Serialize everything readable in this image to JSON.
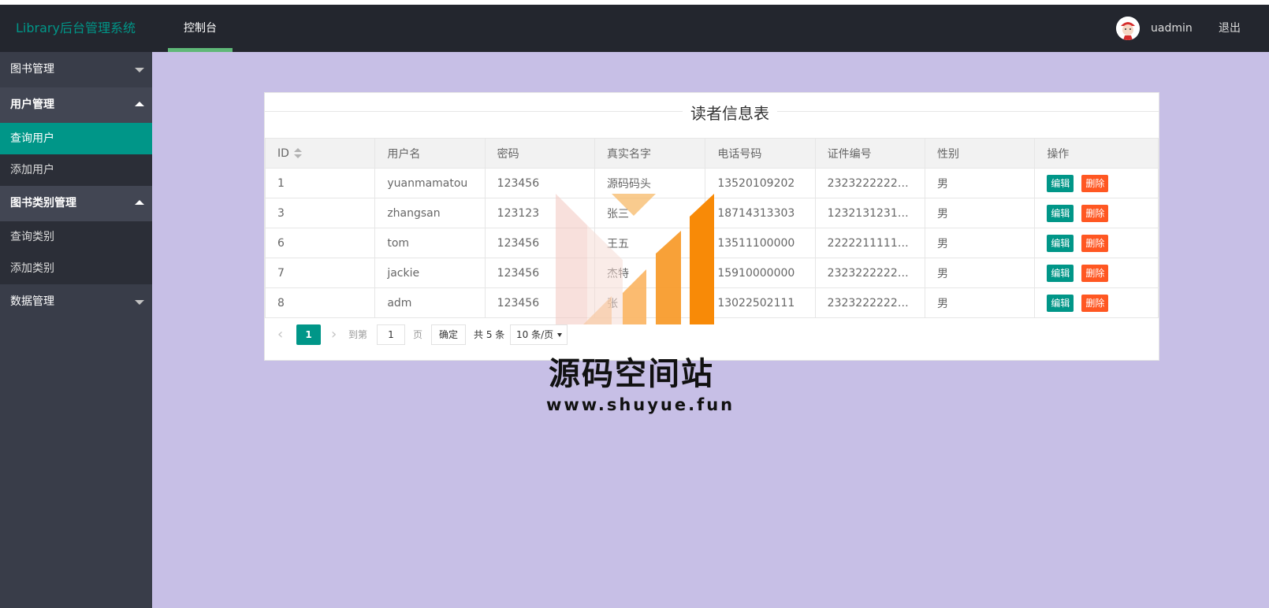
{
  "app": {
    "title": "Library后台管理系统"
  },
  "header": {
    "tab_label": "控制台",
    "username": "uadmin",
    "logout_label": "退出"
  },
  "sidebar": {
    "groups": [
      {
        "label": "图书管理",
        "expanded": false,
        "items": []
      },
      {
        "label": "用户管理",
        "expanded": true,
        "items": [
          {
            "label": "查询用户",
            "active": true
          },
          {
            "label": "添加用户",
            "active": false
          }
        ]
      },
      {
        "label": "图书类别管理",
        "expanded": true,
        "items": [
          {
            "label": "查询类别",
            "active": false
          },
          {
            "label": "添加类别",
            "active": false
          }
        ]
      },
      {
        "label": "数据管理",
        "expanded": false,
        "items": []
      }
    ]
  },
  "panel": {
    "title": "读者信息表",
    "columns": [
      "ID",
      "用户名",
      "密码",
      "真实名字",
      "电话号码",
      "证件编号",
      "性别",
      "操作"
    ],
    "rows": [
      {
        "id": "1",
        "username": "yuanmamatou",
        "password": "123456",
        "realname": "源码码头",
        "phone": "13520109202",
        "idcard": "232322222222...",
        "gender": "男"
      },
      {
        "id": "3",
        "username": "zhangsan",
        "password": "123123",
        "realname": "张三",
        "phone": "18714313303",
        "idcard": "123213123123...",
        "gender": "男"
      },
      {
        "id": "6",
        "username": "tom",
        "password": "123456",
        "realname": "王五",
        "phone": "13511100000",
        "idcard": "2222211111111...",
        "gender": "男"
      },
      {
        "id": "7",
        "username": "jackie",
        "password": "123456",
        "realname": "杰特",
        "phone": "15910000000",
        "idcard": "232322222222...",
        "gender": "男"
      },
      {
        "id": "8",
        "username": "adm",
        "password": "123456",
        "realname": "张",
        "phone": "13022502111",
        "idcard": "232322222222...",
        "gender": "男"
      }
    ],
    "edit_label": "编辑",
    "delete_label": "删除"
  },
  "pager": {
    "current_page": "1",
    "goto_label": "到第",
    "goto_value": "1",
    "page_label": "页",
    "confirm_label": "确定",
    "total_label": "共 5 条",
    "limit_label": "10 条/页"
  },
  "watermark": {
    "title": "源码空间站",
    "url": "www.shuyue.fun"
  },
  "colors": {
    "header_bg": "#23262e",
    "sidebar_bg": "#393d49",
    "accent": "#009688",
    "delete": "#ff5722",
    "main_bg": "#c7bfe6"
  }
}
